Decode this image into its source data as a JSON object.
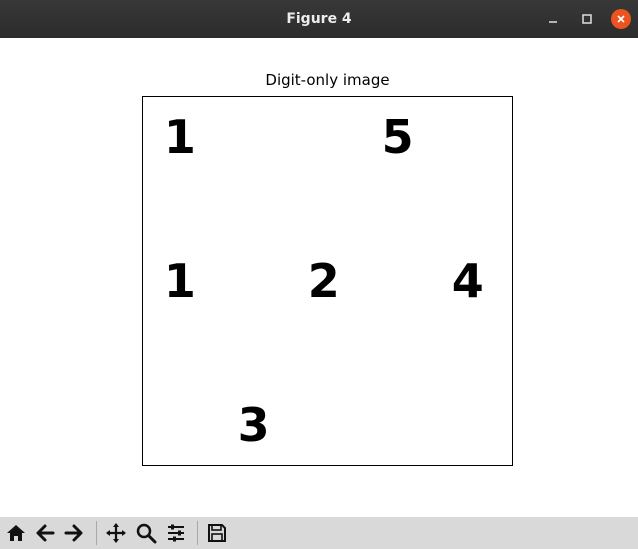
{
  "window": {
    "title": "Figure 4"
  },
  "titlebar_buttons": [
    {
      "icon": "minimize-icon"
    },
    {
      "icon": "maximize-icon"
    },
    {
      "icon": "close-icon",
      "color": "#e95420"
    }
  ],
  "plot": {
    "title": "Digit-only image",
    "axes_visible": false,
    "digits": [
      {
        "text": "1",
        "col": 0.1,
        "row": 0.11
      },
      {
        "text": "5",
        "col": 0.69,
        "row": 0.11
      },
      {
        "text": "1",
        "col": 0.1,
        "row": 0.5
      },
      {
        "text": "2",
        "col": 0.49,
        "row": 0.5
      },
      {
        "text": "4",
        "col": 0.88,
        "row": 0.5
      },
      {
        "text": "3",
        "col": 0.3,
        "row": 0.89
      }
    ]
  },
  "toolbar": {
    "buttons": [
      {
        "icon": "home-icon",
        "name": "home-button"
      },
      {
        "icon": "back-arrow-icon",
        "name": "back-button"
      },
      {
        "icon": "forward-arrow-icon",
        "name": "forward-button"
      },
      {
        "icon": "pan-move-icon",
        "name": "pan-button"
      },
      {
        "icon": "zoom-magnifier-icon",
        "name": "zoom-button"
      },
      {
        "icon": "configure-subplots-icon",
        "name": "configure-button"
      },
      {
        "icon": "save-floppy-icon",
        "name": "save-button"
      }
    ]
  }
}
